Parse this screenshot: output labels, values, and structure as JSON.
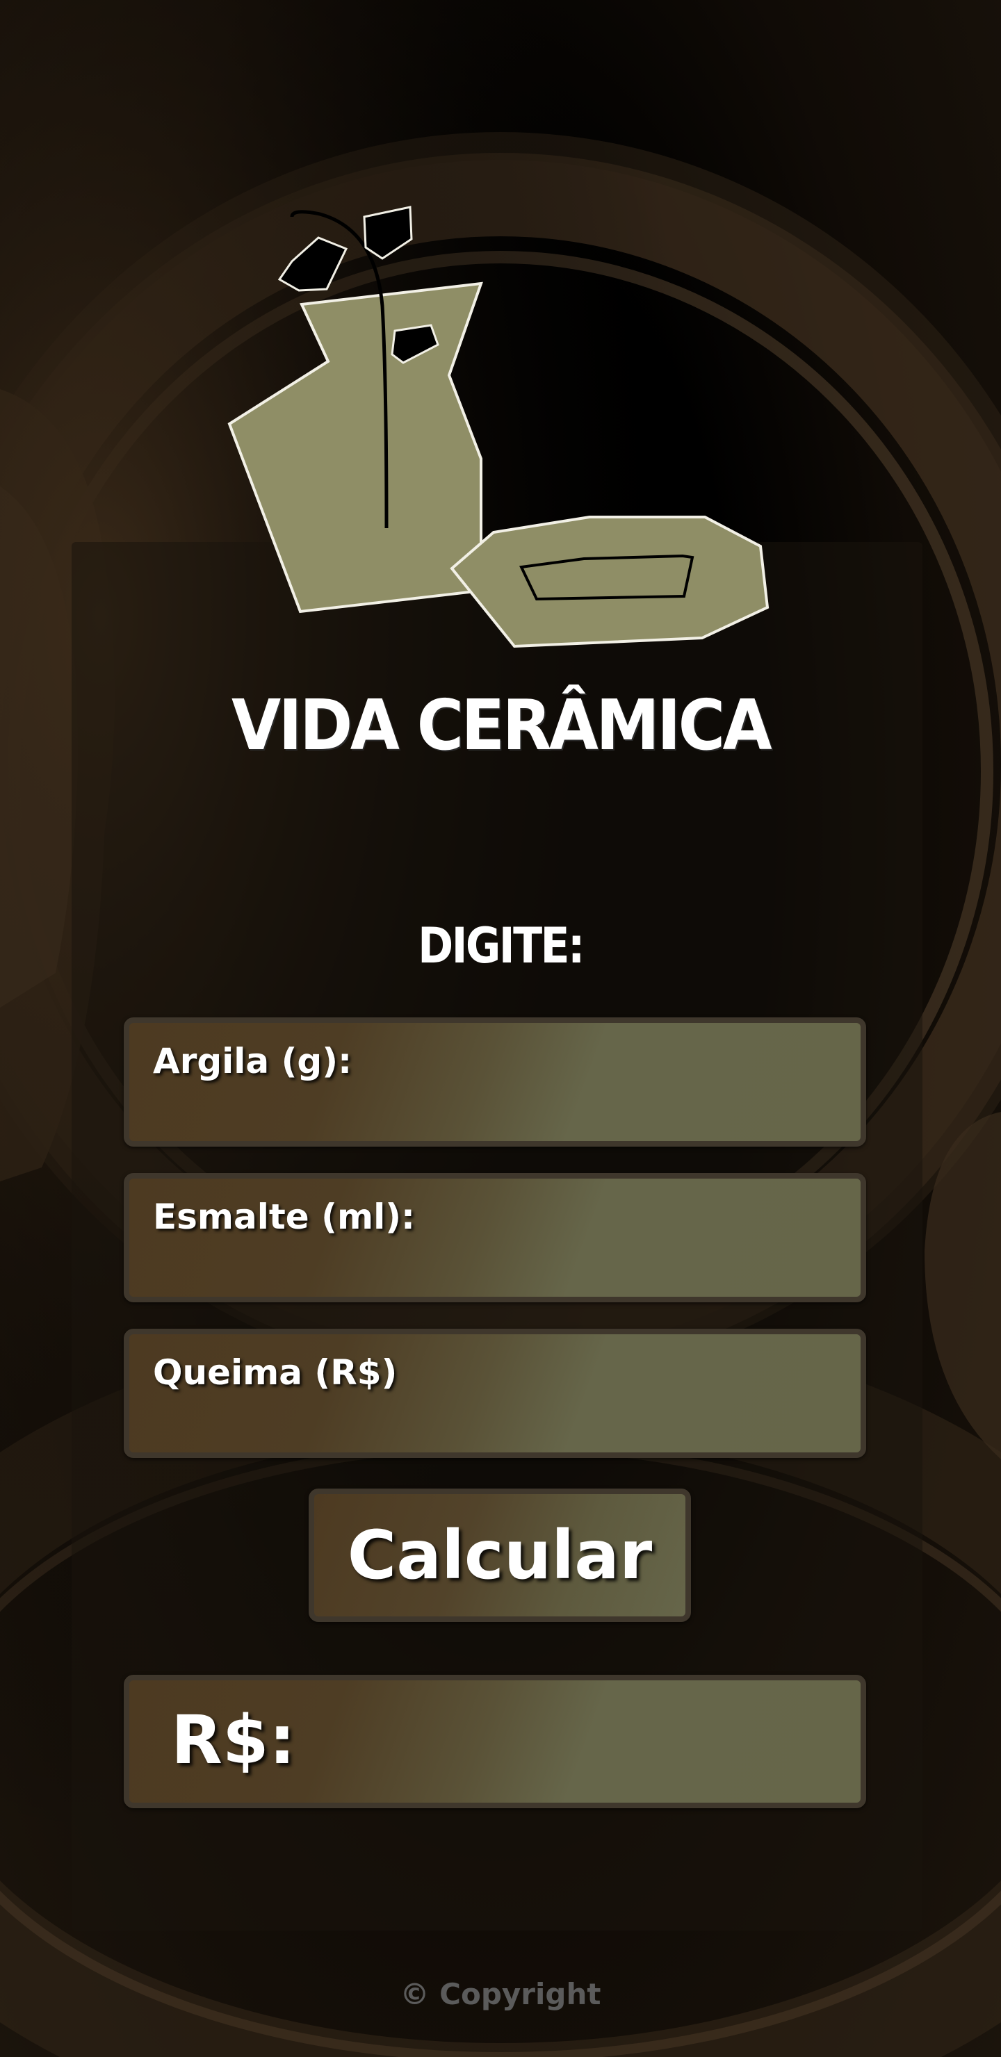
{
  "app": {
    "brand_name": "VIDA CERÂMICA"
  },
  "form": {
    "prompt": "DIGITE:",
    "fields": [
      {
        "label": "Argila (g):",
        "value": ""
      },
      {
        "label": "Esmalte (ml):",
        "value": ""
      },
      {
        "label": "Queima (R$)",
        "value": ""
      }
    ],
    "calculate_label": "Calcular"
  },
  "result": {
    "label": "R$:",
    "value": ""
  },
  "footer": {
    "copyright": "© Copyright"
  },
  "colors": {
    "field_fill": "#66664a",
    "field_fill_dark": "#4d3a21",
    "field_border": "#3f372c",
    "logo_fill": "#8f8e66",
    "footer_text": "#5b5b5b"
  },
  "icons": {
    "logo": "vase-and-dish-icon"
  }
}
